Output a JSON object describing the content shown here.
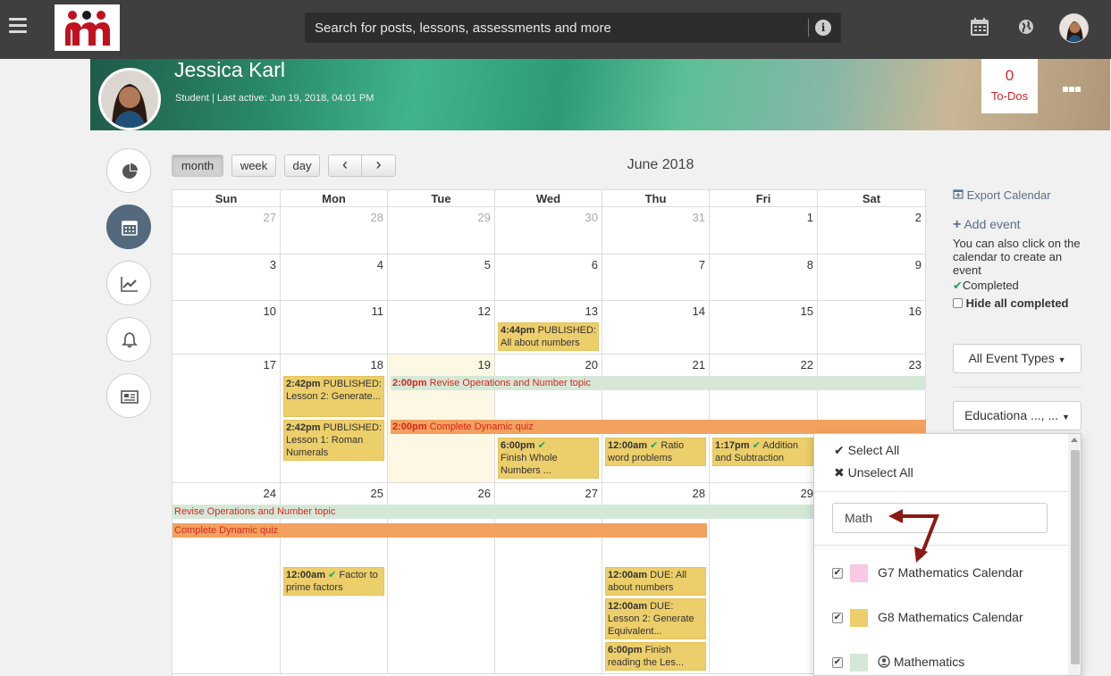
{
  "search": {
    "placeholder": "Search for posts, lessons, assessments and more"
  },
  "profile": {
    "name": "Jessica Karl",
    "subtitle": "Student | Last active: Jun 19, 2018, 04:01 PM",
    "todos_count": "0",
    "todos_label": "To-Dos"
  },
  "toolbar": {
    "month": "month",
    "week": "week",
    "day": "day",
    "prev": "‹",
    "next": "›",
    "title": "June 2018"
  },
  "days_of_week": [
    "Sun",
    "Mon",
    "Tue",
    "Wed",
    "Thu",
    "Fri",
    "Sat"
  ],
  "weeks": [
    [
      "27",
      "28",
      "29",
      "30",
      "31",
      "1",
      "2"
    ],
    [
      "3",
      "4",
      "5",
      "6",
      "7",
      "8",
      "9"
    ],
    [
      "10",
      "11",
      "12",
      "13",
      "14",
      "15",
      "16"
    ],
    [
      "17",
      "18",
      "19",
      "20",
      "21",
      "22",
      "23"
    ],
    [
      "24",
      "25",
      "26",
      "27",
      "28",
      "29",
      ""
    ]
  ],
  "events": {
    "wed13_time": "4:44pm",
    "wed13_text": "PUBLISHED: All about numbers",
    "mon18a_time": "2:42pm",
    "mon18a_text": "PUBLISHED: Lesson 2: Generate...",
    "mon18b_time": "2:42pm",
    "mon18b_text": "PUBLISHED: Lesson 1: Roman Numerals",
    "revise_time": "2:00pm",
    "revise_text": "Revise Operations and Number topic",
    "complete_time": "2:00pm",
    "complete_text": "Complete Dynamic quiz",
    "wed20_time": "6:00pm",
    "wed20_text": "Finish Whole Numbers ...",
    "thu21_time": "12:00am",
    "thu21_text": "Ratio word problems",
    "fri22_time": "1:17pm",
    "fri22_text": "Addition and Subtraction",
    "revise_cont": "Revise Operations and Number topic",
    "complete_cont": "Complete Dynamic quiz",
    "mon25_time": "12:00am",
    "mon25_text": "Factor to prime factors",
    "thu28a_time": "12:00am",
    "thu28a_text": "DUE: All about numbers",
    "thu28b_time": "12:00am",
    "thu28b_text": "DUE: Lesson 2: Generate Equivalent...",
    "thu28c_time": "6:00pm",
    "thu28c_text": "Finish reading the Les..."
  },
  "right_panel": {
    "export": "Export Calendar",
    "add_event": "Add event",
    "add_hint": "You can also click on the calendar to create an event",
    "completed": "Completed",
    "hide_completed": "Hide all completed",
    "event_types": "All Event Types",
    "calendars_dd": "Educationa ..., ..."
  },
  "filter_menu": {
    "select_all": "Select All",
    "unselect_all": "Unselect All",
    "filter_value": "Math",
    "calendars": [
      {
        "label": "G7 Mathematics Calendar",
        "color": "#f8c8e4"
      },
      {
        "label": "G8 Mathematics Calendar",
        "color": "#ecce6a"
      },
      {
        "label": "Mathematics",
        "color": "#d5e8d8"
      }
    ]
  }
}
